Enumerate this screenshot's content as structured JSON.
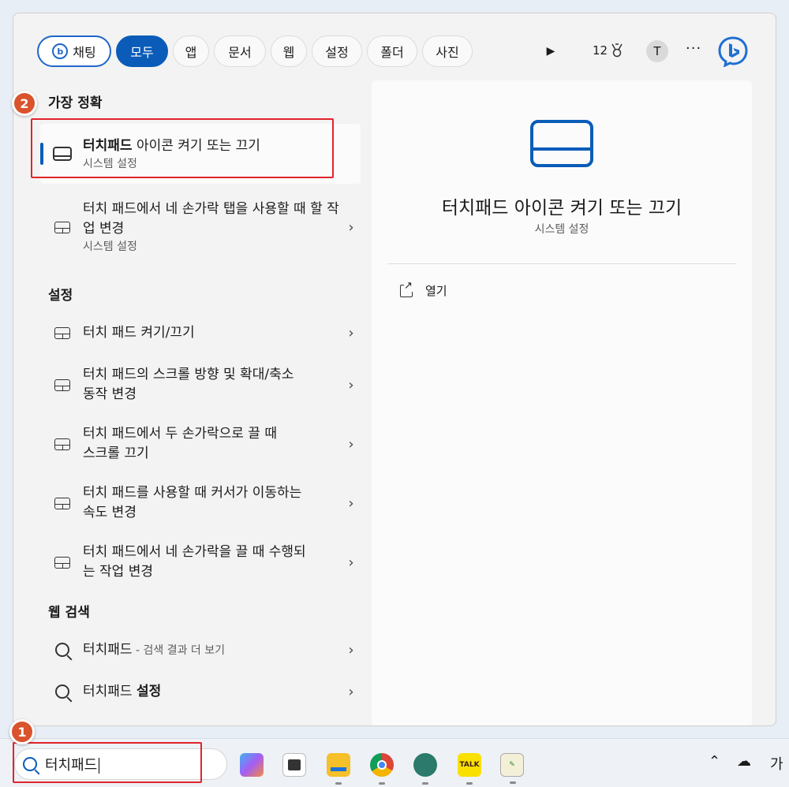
{
  "filters": {
    "chat": "채팅",
    "all": "모두",
    "apps": "앱",
    "documents": "문서",
    "web": "웹",
    "settings": "설정",
    "folders": "폴더",
    "photos": "사진",
    "points": "12",
    "avatar": "T",
    "more": "···"
  },
  "left": {
    "best_match_title": "가장 정확",
    "best_match": {
      "label_bold": "터치패드",
      "label_rest": " 아이콘 켜기 또는 끄기",
      "sub": "시스템 설정"
    },
    "second_match": {
      "label": "터치 패드에서 네 손가락 탭을 사용할 때 할 작업 변경",
      "sub": "시스템 설정"
    },
    "settings_title": "설정",
    "settings_items": [
      "터치 패드 켜기/끄기",
      "터치 패드의 스크롤 방향 및 확대/축소 동작 변경",
      "터치 패드에서 두 손가락으로 끌 때 스크롤 끄기",
      "터치 패드를 사용할 때 커서가 이동하는 속도 변경",
      "터치 패드에서 네 손가락을 끌 때 수행되는 작업 변경"
    ],
    "web_title": "웹 검색",
    "web_items": [
      {
        "main": "터치패드",
        "suffix": " - 검색 결과 더 보기"
      },
      {
        "main": "터치패드 ",
        "bold": "설정"
      }
    ]
  },
  "right": {
    "title": "터치패드 아이콘 켜기 또는 끄기",
    "sub": "시스템 설정",
    "open": "열기"
  },
  "badges": {
    "one": "1",
    "two": "2"
  },
  "taskbar": {
    "search_value": "터치패드",
    "ime": "가"
  },
  "colors": {
    "accent": "#0a5cb8",
    "highlight": "#e0242c",
    "badge": "#d9532c"
  }
}
